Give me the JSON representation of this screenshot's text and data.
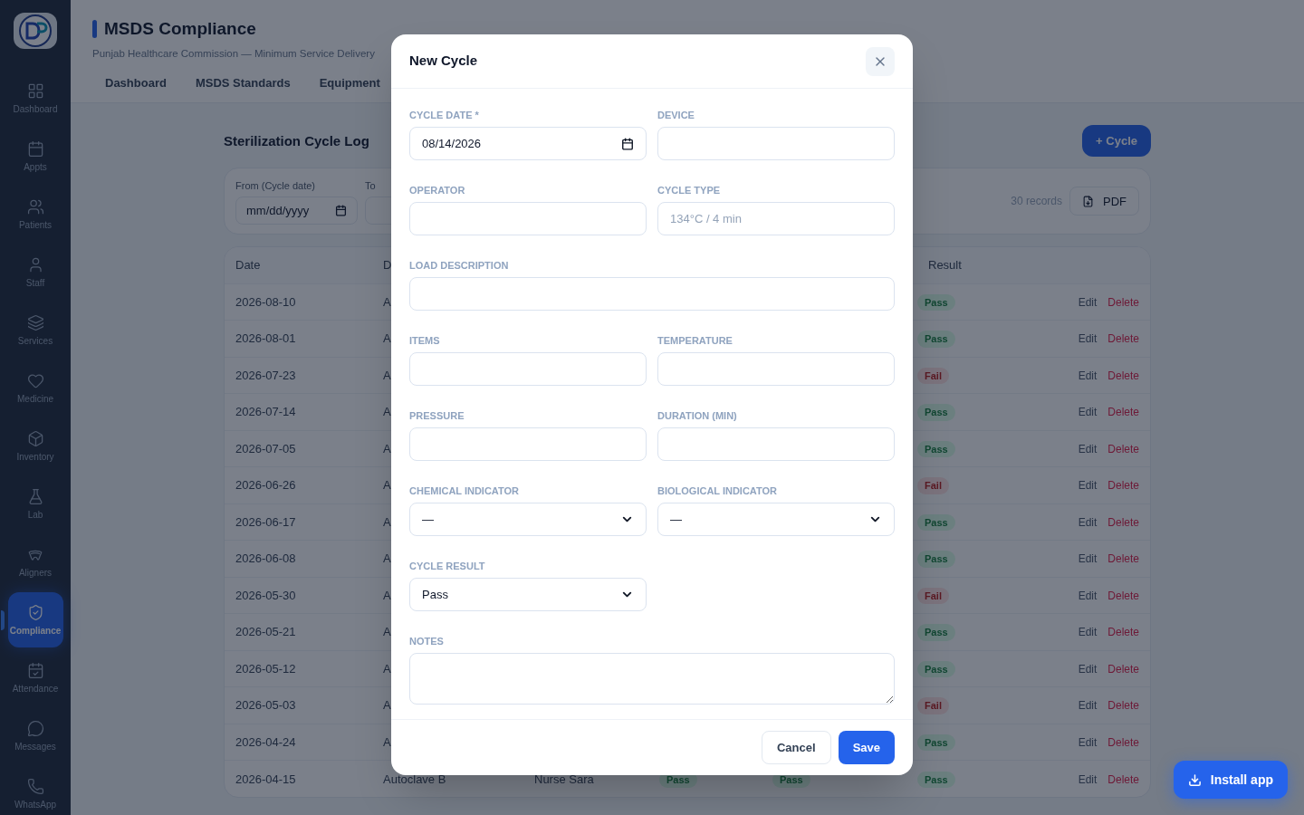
{
  "sidebar": {
    "items": [
      {
        "label": "Dashboard",
        "selected": false
      },
      {
        "label": "Appts",
        "selected": false
      },
      {
        "label": "Patients",
        "selected": false
      },
      {
        "label": "Staff",
        "selected": false
      },
      {
        "label": "Services",
        "selected": false
      },
      {
        "label": "Medicine",
        "selected": false
      },
      {
        "label": "Inventory",
        "selected": false
      },
      {
        "label": "Lab",
        "selected": false
      },
      {
        "label": "Aligners",
        "selected": false
      },
      {
        "label": "Compliance",
        "selected": true
      },
      {
        "label": "Attendance",
        "selected": false
      },
      {
        "label": "Messages",
        "selected": false
      },
      {
        "label": "WhatsApp",
        "selected": false
      }
    ]
  },
  "header": {
    "title": "MSDS Compliance",
    "subtitle": "Punjab Healthcare Commission — Minimum Service Delivery"
  },
  "tabs": [
    {
      "label": "Dashboard",
      "selected": false
    },
    {
      "label": "MSDS Standards",
      "selected": false
    },
    {
      "label": "Equipment",
      "selected": false
    }
  ],
  "section": {
    "title": "Sterilization Cycle Log",
    "add_button": "+ Cycle"
  },
  "filters": {
    "from_label": "From (Cycle date)",
    "from_placeholder": "mm/dd/yyyy",
    "to_label": "To",
    "records": "30 records",
    "pdf_button": "PDF"
  },
  "table": {
    "columns": [
      "Date",
      "D",
      "",
      "",
      "",
      "Result"
    ],
    "rows": [
      {
        "date": "2026-08-10",
        "device": "A",
        "result": {
          "text": "Pass",
          "kind": "pass"
        },
        "actions": [
          "Edit",
          "Delete"
        ]
      },
      {
        "date": "2026-08-01",
        "device": "A",
        "result": {
          "text": "Pass",
          "kind": "pass"
        },
        "actions": [
          "Edit",
          "Delete"
        ]
      },
      {
        "date": "2026-07-23",
        "device": "A",
        "result": {
          "text": "Fail",
          "kind": "fail"
        },
        "actions": [
          "Edit",
          "Delete"
        ]
      },
      {
        "date": "2026-07-14",
        "device": "A",
        "result": {
          "text": "Pass",
          "kind": "pass"
        },
        "actions": [
          "Edit",
          "Delete"
        ]
      },
      {
        "date": "2026-07-05",
        "device": "A",
        "result": {
          "text": "Pass",
          "kind": "pass"
        },
        "actions": [
          "Edit",
          "Delete"
        ]
      },
      {
        "date": "2026-06-26",
        "device": "A",
        "result": {
          "text": "Fail",
          "kind": "fail"
        },
        "actions": [
          "Edit",
          "Delete"
        ]
      },
      {
        "date": "2026-06-17",
        "device": "A",
        "result": {
          "text": "Pass",
          "kind": "pass"
        },
        "actions": [
          "Edit",
          "Delete"
        ]
      },
      {
        "date": "2026-06-08",
        "device": "A",
        "result": {
          "text": "Pass",
          "kind": "pass"
        },
        "actions": [
          "Edit",
          "Delete"
        ]
      },
      {
        "date": "2026-05-30",
        "device": "A",
        "result": {
          "text": "Fail",
          "kind": "fail"
        },
        "actions": [
          "Edit",
          "Delete"
        ]
      },
      {
        "date": "2026-05-21",
        "device": "A",
        "result": {
          "text": "Pass",
          "kind": "pass"
        },
        "actions": [
          "Edit",
          "Delete"
        ]
      },
      {
        "date": "2026-05-12",
        "device": "A",
        "result": {
          "text": "Pass",
          "kind": "pass"
        },
        "actions": [
          "Edit",
          "Delete"
        ]
      },
      {
        "date": "2026-05-03",
        "device": "A",
        "result": {
          "text": "Fail",
          "kind": "fail"
        },
        "actions": [
          "Edit",
          "Delete"
        ]
      },
      {
        "date": "2026-04-24",
        "device": "A",
        "result": {
          "text": "Pass",
          "kind": "pass"
        },
        "actions": [
          "Edit",
          "Delete"
        ]
      },
      {
        "date": "2026-04-15",
        "device": "Autoclave B",
        "operator": "Nurse Sara",
        "chemical": {
          "text": "Pass",
          "kind": "pass"
        },
        "biological": {
          "text": "Pass",
          "kind": "pass"
        },
        "result": {
          "text": "Pass",
          "kind": "pass"
        },
        "actions": [
          "Edit",
          "Delete"
        ]
      }
    ]
  },
  "modal": {
    "title": "New Cycle",
    "fields": [
      {
        "label": "CYCLE DATE *",
        "kind": "date",
        "value": "08/14/2026",
        "wide": false
      },
      {
        "label": "DEVICE",
        "kind": "text",
        "wide": false
      },
      {
        "label": "OPERATOR",
        "kind": "text",
        "wide": false
      },
      {
        "label": "CYCLE TYPE",
        "kind": "text",
        "placeholder": "134°C / 4 min",
        "wide": false
      },
      {
        "label": "LOAD DESCRIPTION",
        "kind": "text",
        "wide": true
      },
      {
        "label": "ITEMS",
        "kind": "text",
        "wide": false
      },
      {
        "label": "TEMPERATURE",
        "kind": "text",
        "wide": false
      },
      {
        "label": "PRESSURE",
        "kind": "text",
        "wide": false
      },
      {
        "label": "DURATION (MIN)",
        "kind": "text",
        "wide": false
      },
      {
        "label": "CHEMICAL INDICATOR",
        "kind": "select",
        "value": "—",
        "wide": false
      },
      {
        "label": "BIOLOGICAL INDICATOR",
        "kind": "select",
        "value": "—",
        "wide": false
      },
      {
        "label": "CYCLE RESULT",
        "kind": "select",
        "value": "Pass",
        "wide": false
      },
      {
        "label": "NOTES",
        "kind": "textarea",
        "wide": true
      }
    ],
    "buttons": [
      {
        "label": "Cancel",
        "kind": "secondary"
      },
      {
        "label": "Save",
        "kind": "primary"
      }
    ]
  },
  "install_button": "Install app"
}
